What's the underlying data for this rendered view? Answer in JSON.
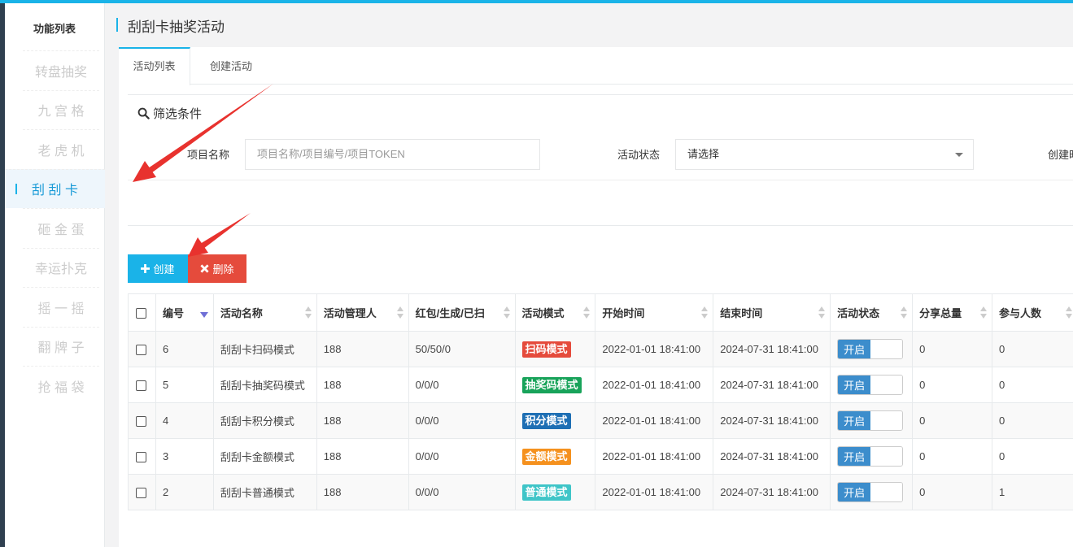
{
  "sidebar": {
    "title": "功能列表",
    "items": [
      {
        "label": "转盘抽奖",
        "active": false
      },
      {
        "label": "九 宫 格",
        "active": false
      },
      {
        "label": "老 虎 机",
        "active": false
      },
      {
        "label": "刮 刮 卡",
        "active": true
      },
      {
        "label": "砸 金 蛋",
        "active": false
      },
      {
        "label": "幸运扑克",
        "active": false
      },
      {
        "label": "摇 一 摇",
        "active": false
      },
      {
        "label": "翻 牌 子",
        "active": false
      },
      {
        "label": "抢 福 袋",
        "active": false
      }
    ]
  },
  "page": {
    "title": "刮刮卡抽奖活动"
  },
  "tabs": [
    {
      "label": "活动列表",
      "active": true
    },
    {
      "label": "创建活动",
      "active": false
    }
  ],
  "filter": {
    "title": "筛选条件",
    "project_label": "项目名称",
    "project_placeholder": "项目名称/项目编号/项目TOKEN",
    "status_label": "活动状态",
    "status_value": "请选择",
    "created_label": "创建时"
  },
  "toolbar": {
    "create_label": "创建",
    "delete_label": "删除"
  },
  "table": {
    "headers": [
      "编号",
      "活动名称",
      "活动管理人",
      "红包/生成/已扫",
      "活动模式",
      "开始时间",
      "结束时间",
      "活动状态",
      "分享总量",
      "参与人数"
    ],
    "rows": [
      {
        "id": "6",
        "name": "刮刮卡扫码模式",
        "manager": "188",
        "red": "50/50/0",
        "mode": "扫码模式",
        "mode_color": "#e54b3c",
        "start": "2022-01-01 18:41:00",
        "end": "2024-07-31 18:41:00",
        "status": "开启",
        "share": "0",
        "participants": "0"
      },
      {
        "id": "5",
        "name": "刮刮卡抽奖码模式",
        "manager": "188",
        "red": "0/0/0",
        "mode": "抽奖码模式",
        "mode_color": "#18a35a",
        "start": "2022-01-01 18:41:00",
        "end": "2024-07-31 18:41:00",
        "status": "开启",
        "share": "0",
        "participants": "0"
      },
      {
        "id": "4",
        "name": "刮刮卡积分模式",
        "manager": "188",
        "red": "0/0/0",
        "mode": "积分模式",
        "mode_color": "#1e6fb4",
        "start": "2022-01-01 18:41:00",
        "end": "2024-07-31 18:41:00",
        "status": "开启",
        "share": "0",
        "participants": "0"
      },
      {
        "id": "3",
        "name": "刮刮卡金额模式",
        "manager": "188",
        "red": "0/0/0",
        "mode": "金额模式",
        "mode_color": "#f5911e",
        "start": "2022-01-01 18:41:00",
        "end": "2024-07-31 18:41:00",
        "status": "开启",
        "share": "0",
        "participants": "0"
      },
      {
        "id": "2",
        "name": "刮刮卡普通模式",
        "manager": "188",
        "red": "0/0/0",
        "mode": "普通模式",
        "mode_color": "#3fc5c8",
        "start": "2022-01-01 18:41:00",
        "end": "2024-07-31 18:41:00",
        "status": "开启",
        "share": "0",
        "participants": "1"
      }
    ]
  },
  "colors": {
    "accent": "#1ab3e8",
    "danger": "#e54b3c",
    "arrow": "#e8322e"
  },
  "icons": {
    "filter": "search-icon",
    "create": "plus-icon",
    "delete": "times-icon"
  }
}
